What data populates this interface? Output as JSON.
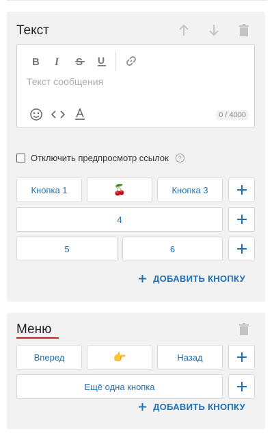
{
  "text_block": {
    "title": "Текст",
    "editor": {
      "placeholder": "Текст сообщения",
      "counter": "0 / 4000"
    },
    "disable_preview_label": "Отключить предпросмотр ссылок",
    "help_icon": "?",
    "buttons": [
      [
        "Кнопка 1",
        "🍒",
        "Кнопка 3"
      ],
      [
        "4"
      ],
      [
        "5",
        "6"
      ]
    ],
    "add_button_label": "ДОБАВИТЬ КНОПКУ"
  },
  "menu_block": {
    "title": "Меню",
    "buttons": [
      [
        "Вперед",
        "👉",
        "Назад"
      ],
      [
        "Ещё одна кнопка"
      ]
    ],
    "add_button_label": "ДОБАВИТЬ КНОПКУ"
  },
  "colors": {
    "accent": "#1f6fb2",
    "card_bg": "#f2f2f2",
    "underline": "#c8202a"
  }
}
